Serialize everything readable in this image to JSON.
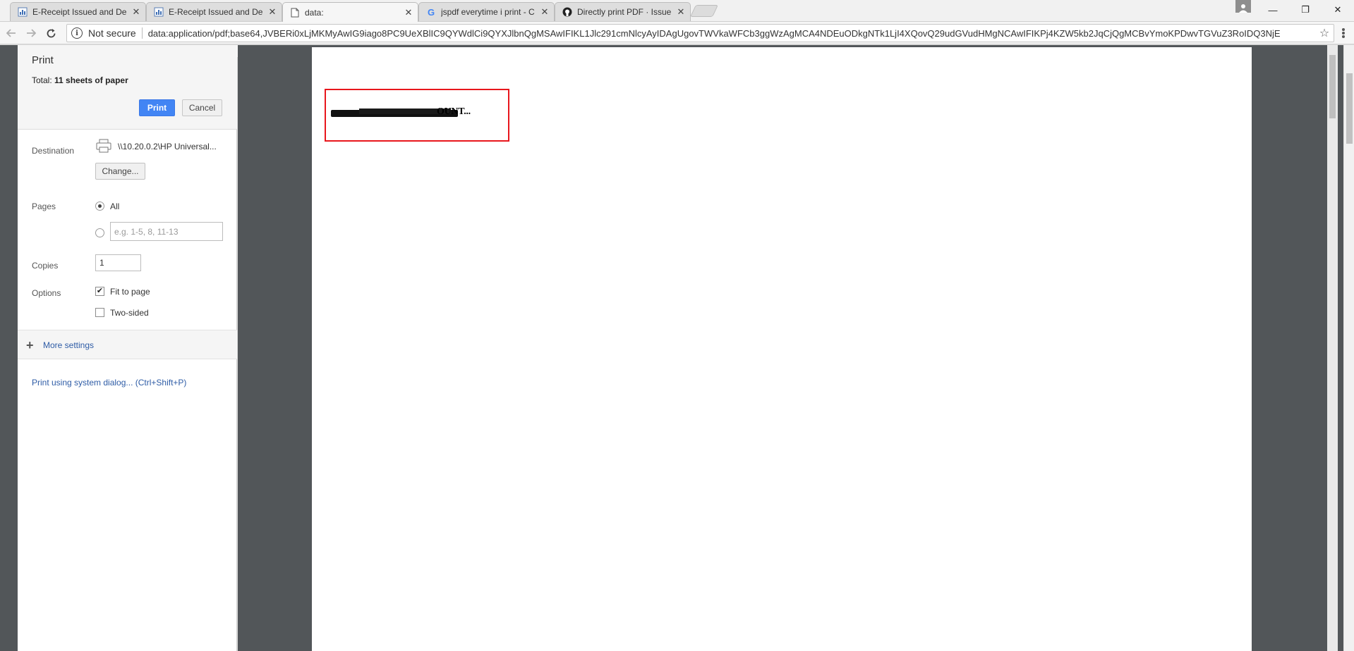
{
  "tabs": [
    {
      "title": "E-Receipt Issued and De",
      "close": "✕",
      "favicon": "doc-chart-icon"
    },
    {
      "title": "E-Receipt Issued and De",
      "close": "✕",
      "favicon": "doc-chart-icon"
    },
    {
      "title": "data:",
      "close": "✕",
      "favicon": "page-icon",
      "active": true
    },
    {
      "title": "jspdf everytime i print - C",
      "close": "✕",
      "favicon": "google-icon"
    },
    {
      "title": "Directly print PDF · Issue",
      "close": "✕",
      "favicon": "github-icon"
    }
  ],
  "window_controls": {
    "minimize": "—",
    "maximize": "❐",
    "close": "✕"
  },
  "omnibox": {
    "security_label": "Not secure",
    "url": "data:application/pdf;base64,JVBERi0xLjMKMyAwIG9iago8PC9UeXBlIC9QYWdlCi9QYXJlbnQgMSAwIFIKL1Jlc291cmNlcyAyIDAgUgovTWVkaWFCb3ggWzAgMCA4NDEuODkgNTk1LjI4XQovQ29udGVudHMgNCAwIFIKPj4KZW5kb2JqCjQgMCBvYmoKPDwvTGVuZ3RoIDQ3NjE"
  },
  "print_panel": {
    "title": "Print",
    "total_label": "Total:",
    "total_value": "11 sheets of paper",
    "print_button": "Print",
    "cancel_button": "Cancel",
    "destination_label": "Destination",
    "destination_value": "\\\\10.20.0.2\\HP Universal...",
    "change_button": "Change...",
    "pages_label": "Pages",
    "pages_all": "All",
    "pages_custom_placeholder": "e.g. 1-5, 8, 11-13",
    "copies_label": "Copies",
    "copies_value": "1",
    "options_label": "Options",
    "fit_to_page": "Fit to page",
    "fit_to_page_checked": true,
    "two_sided": "Two-sided",
    "two_sided_checked": false,
    "more_settings": "More settings",
    "system_dialog": "Print using system dialog... (Ctrl+Shift+P)"
  },
  "preview": {
    "garbled_text": "OUNT...",
    "highlight_color": "#e8161c"
  },
  "colors": {
    "print_button": "#4285f4",
    "preview_bg": "#525659",
    "link": "#2e5ca6"
  }
}
